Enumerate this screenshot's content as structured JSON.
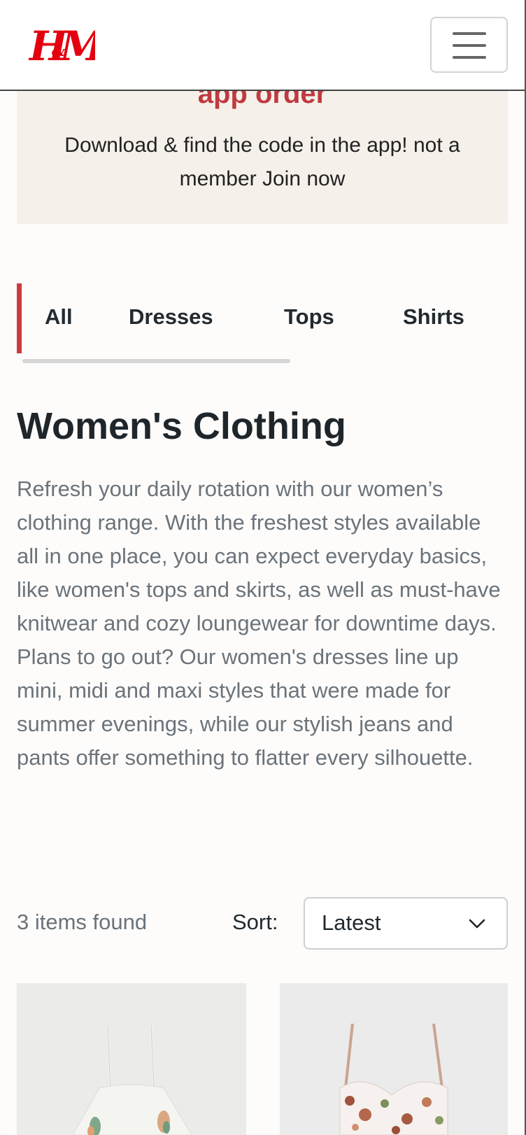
{
  "header": {
    "logo_text": "H&M",
    "logo_color": "#e50010",
    "menu_icon": "hamburger-icon"
  },
  "promo": {
    "title": "app order",
    "text": "Download & find the code in the app! not a member Join now",
    "title_color": "#c0393f",
    "background": "#f5f1ea"
  },
  "tabs": {
    "items": [
      {
        "label": "All",
        "active": true
      },
      {
        "label": "Dresses",
        "active": false
      },
      {
        "label": "Tops",
        "active": false
      },
      {
        "label": "Shirts",
        "active": false
      }
    ],
    "accent_color": "#cc3a40"
  },
  "main": {
    "title": "Women's Clothing",
    "description": "Refresh your daily rotation with our women’s clothing range. With the freshest styles available all in one place, you can expect everyday basics, like women's tops and skirts, as well as must-have knitwear and cozy loungewear for downtime days. Plans to go out? Our women's dresses line up mini, midi and maxi styles that were made for summer evenings, while our stylish jeans and pants offer something to flatter every silhouette."
  },
  "results": {
    "count_text": "3 items found",
    "sort_label": "Sort:",
    "sort_value": "Latest",
    "sort_icon": "chevron-down-icon"
  },
  "products": [
    {
      "image": "white floral strappy dress"
    },
    {
      "image": "floral print bustier dress"
    }
  ]
}
